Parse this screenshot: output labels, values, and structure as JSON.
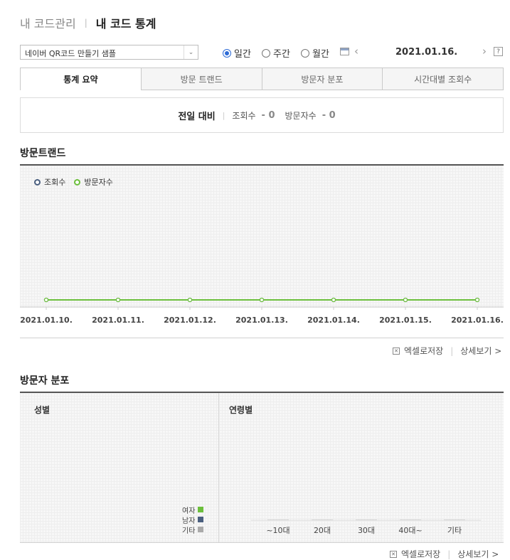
{
  "breadcrumb": {
    "parent": "내 코드관리",
    "current": "내 코드 통계"
  },
  "toolbar": {
    "code_select": "네이버 QR코드 만들기 샘플",
    "period_options": [
      {
        "label": "일간",
        "selected": true
      },
      {
        "label": "주간",
        "selected": false
      },
      {
        "label": "월간",
        "selected": false
      }
    ],
    "date": "2021.01.16.",
    "help": "?"
  },
  "tabs": [
    {
      "label": "통계 요약",
      "active": true
    },
    {
      "label": "방문 트랜드",
      "active": false
    },
    {
      "label": "방문자 분포",
      "active": false
    },
    {
      "label": "시간대별 조회수",
      "active": false
    }
  ],
  "summary": {
    "label": "전일 대비",
    "views_label": "조회수",
    "views_value": "- 0",
    "visitors_label": "방문자수",
    "visitors_value": "- 0"
  },
  "trend": {
    "title": "방문트랜드",
    "legend": [
      {
        "name": "조회수",
        "color": "#4a5f7f"
      },
      {
        "name": "방문자수",
        "color": "#6cbf3c"
      }
    ]
  },
  "chart_data": {
    "type": "line",
    "x": [
      "2021.01.10.",
      "2021.01.11.",
      "2021.01.12.",
      "2021.01.13.",
      "2021.01.14.",
      "2021.01.15.",
      "2021.01.16."
    ],
    "series": [
      {
        "name": "조회수",
        "values": [
          0,
          0,
          0,
          0,
          0,
          0,
          0
        ],
        "color": "#4a5f7f"
      },
      {
        "name": "방문자수",
        "values": [
          0,
          0,
          0,
          0,
          0,
          0,
          0
        ],
        "color": "#6cbf3c"
      }
    ],
    "grid": true,
    "legend_position": "top-left"
  },
  "actions": {
    "excel": "엑셀로저장",
    "detail": "상세보기 >"
  },
  "distribution": {
    "title": "방문자 분포",
    "gender_label": "성별",
    "gender_legend": [
      {
        "name": "여자",
        "color": "#6cbf3c"
      },
      {
        "name": "남자",
        "color": "#4a5f7f"
      },
      {
        "name": "기타",
        "color": "#aaaaaa"
      }
    ],
    "age_label": "연령별",
    "age_categories": [
      "~10대",
      "20대",
      "30대",
      "40대~",
      "기타"
    ],
    "age_values": [
      0,
      0,
      0,
      0,
      0
    ]
  }
}
